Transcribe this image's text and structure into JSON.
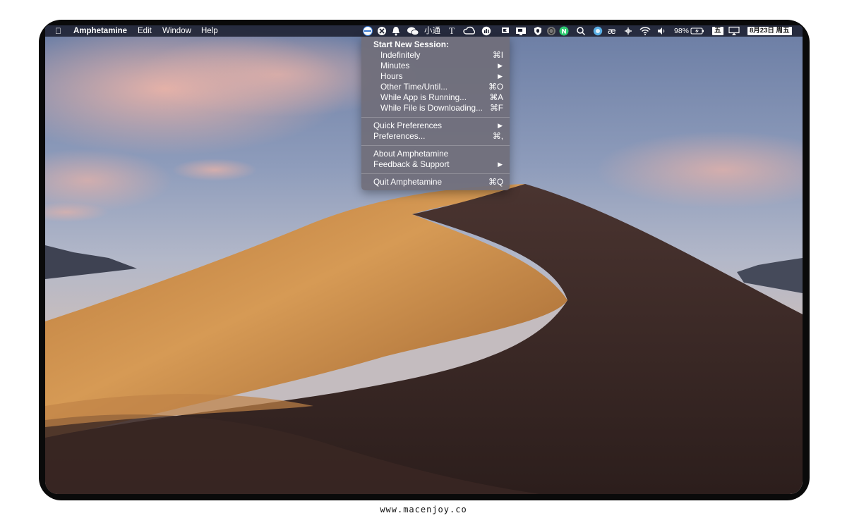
{
  "menubar": {
    "apple_icon": "apple-logo-icon",
    "app_name": "Amphetamine",
    "menus": [
      "Edit",
      "Window",
      "Help"
    ],
    "tray_text_1": "小通",
    "tray_text_2": "T",
    "tray_text_3": "æ",
    "battery_percent": "98%",
    "input_method": "五",
    "date": "8月23日 周五"
  },
  "menu": {
    "header": "Start New Session:",
    "session_items": [
      {
        "label": "Indefinitely",
        "shortcut": "⌘I"
      },
      {
        "label": "Minutes",
        "shortcut": "▶"
      },
      {
        "label": "Hours",
        "shortcut": "▶"
      },
      {
        "label": "Other Time/Until...",
        "shortcut": "⌘O"
      },
      {
        "label": "While App is Running...",
        "shortcut": "⌘A"
      },
      {
        "label": "While File is Downloading...",
        "shortcut": "⌘F"
      }
    ],
    "quick_preferences": {
      "label": "Quick Preferences",
      "shortcut": "▶"
    },
    "preferences": {
      "label": "Preferences...",
      "shortcut": "⌘,"
    },
    "about": {
      "label": "About Amphetamine"
    },
    "feedback": {
      "label": "Feedback & Support",
      "shortcut": "▶"
    },
    "quit": {
      "label": "Quit Amphetamine",
      "shortcut": "⌘Q"
    }
  },
  "footer": {
    "url": "www.macenjoy.co"
  },
  "colors": {
    "menubar": "#1c2030",
    "menu_bg": "#706e7a",
    "dune_light": "#c88a45",
    "dune_shadow": "#3a2620"
  }
}
